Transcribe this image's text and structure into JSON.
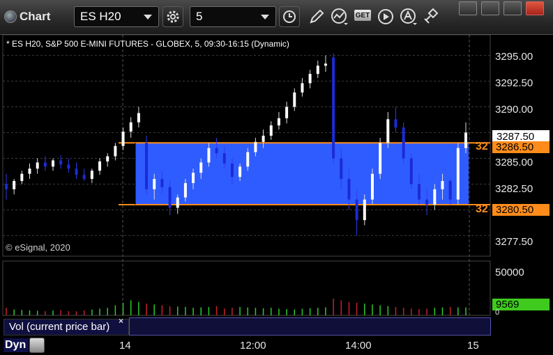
{
  "app": {
    "title": "Chart"
  },
  "toolbar": {
    "symbol": "ES H20",
    "interval": "5",
    "get_label": "GET"
  },
  "chart": {
    "header": "* ES H20, S&P 500 E-MINI FUTURES - GLOBEX, 5, 09:30-16:15 (Dynamic)",
    "copyright": "© eSignal, 2020",
    "price_ticks": [
      "3295.00",
      "3292.50",
      "3290.00",
      "3287.50",
      "3285.00",
      "3282.50",
      "3280.00",
      "3277.50"
    ],
    "tags": {
      "last": "3287.50",
      "upper_line": "3286.50",
      "lower_line": "3280.50",
      "volume": "9569"
    },
    "line_labels": {
      "upper": "32",
      "lower": "32"
    },
    "volume_ticks": [
      "50000",
      "0"
    ],
    "time_ticks": [
      "14",
      "12:00",
      "14:00",
      "15"
    ],
    "volume_panel_label": "Vol (current price bar)",
    "volume_panel_close": "×",
    "dyn_label": "Dyn"
  },
  "colors": {
    "up_candle": "#ffffff",
    "down_candle": "#1a2bd6",
    "band_fill": "#2f5cff",
    "band_line": "#ff8c1a",
    "vol_up": "#2fc82f",
    "vol_down": "#c8202a",
    "grid": "#3a3a3a"
  },
  "chart_data": {
    "type": "candlestick",
    "price_range": [
      3275.5,
      3297.0
    ],
    "volume_range": [
      0,
      65000
    ],
    "band": {
      "top": 3286.5,
      "bottom": 3280.5
    },
    "candles": [
      [
        3282.5,
        3283.5,
        3281.0,
        3282.0
      ],
      [
        3282.0,
        3283.0,
        3281.5,
        3282.8
      ],
      [
        3282.8,
        3283.8,
        3282.5,
        3283.5
      ],
      [
        3283.5,
        3284.5,
        3283.0,
        3284.0
      ],
      [
        3284.0,
        3285.0,
        3283.5,
        3284.6
      ],
      [
        3284.6,
        3285.2,
        3283.8,
        3284.2
      ],
      [
        3284.2,
        3285.0,
        3283.8,
        3284.8
      ],
      [
        3284.8,
        3285.3,
        3284.0,
        3284.4
      ],
      [
        3284.4,
        3285.0,
        3283.6,
        3284.0
      ],
      [
        3284.0,
        3284.6,
        3283.0,
        3283.4
      ],
      [
        3283.4,
        3284.0,
        3282.8,
        3283.0
      ],
      [
        3283.0,
        3284.0,
        3282.6,
        3283.8
      ],
      [
        3283.8,
        3285.0,
        3283.4,
        3284.7
      ],
      [
        3284.7,
        3285.5,
        3284.2,
        3285.2
      ],
      [
        3285.2,
        3286.5,
        3284.8,
        3286.2
      ],
      [
        3286.2,
        3288.0,
        3285.8,
        3287.6
      ],
      [
        3287.6,
        3289.0,
        3287.0,
        3288.5
      ],
      [
        3288.5,
        3290.0,
        3288.0,
        3289.4
      ],
      [
        3286.5,
        3287.2,
        3281.5,
        3282.0
      ],
      [
        3282.0,
        3283.5,
        3281.0,
        3283.0
      ],
      [
        3283.0,
        3283.8,
        3281.6,
        3282.2
      ],
      [
        3282.2,
        3282.8,
        3279.5,
        3280.2
      ],
      [
        3280.2,
        3281.5,
        3279.6,
        3281.2
      ],
      [
        3281.2,
        3283.0,
        3280.8,
        3282.6
      ],
      [
        3282.6,
        3284.0,
        3282.0,
        3283.6
      ],
      [
        3283.6,
        3285.0,
        3283.0,
        3284.6
      ],
      [
        3284.6,
        3286.5,
        3284.2,
        3286.0
      ],
      [
        3286.0,
        3287.0,
        3285.0,
        3285.5
      ],
      [
        3285.5,
        3286.2,
        3284.0,
        3284.5
      ],
      [
        3284.5,
        3285.0,
        3282.5,
        3283.2
      ],
      [
        3283.2,
        3284.5,
        3282.8,
        3284.2
      ],
      [
        3284.2,
        3286.0,
        3283.8,
        3285.6
      ],
      [
        3285.6,
        3287.0,
        3285.2,
        3286.6
      ],
      [
        3286.6,
        3287.8,
        3286.0,
        3287.2
      ],
      [
        3287.2,
        3288.6,
        3286.8,
        3288.2
      ],
      [
        3288.2,
        3289.5,
        3287.8,
        3288.9
      ],
      [
        3288.9,
        3290.5,
        3288.4,
        3290.0
      ],
      [
        3290.0,
        3291.8,
        3289.6,
        3291.4
      ],
      [
        3291.4,
        3292.8,
        3291.0,
        3292.3
      ],
      [
        3292.3,
        3293.6,
        3291.8,
        3293.2
      ],
      [
        3293.2,
        3294.5,
        3292.8,
        3294.0
      ],
      [
        3294.0,
        3295.0,
        3293.4,
        3294.2
      ],
      [
        3294.8,
        3295.2,
        3284.5,
        3285.0
      ],
      [
        3285.0,
        3286.0,
        3282.0,
        3283.0
      ],
      [
        3283.0,
        3284.0,
        3280.0,
        3281.0
      ],
      [
        3281.0,
        3282.0,
        3277.5,
        3279.0
      ],
      [
        3279.0,
        3281.5,
        3278.5,
        3281.0
      ],
      [
        3281.0,
        3284.0,
        3280.5,
        3283.5
      ],
      [
        3283.5,
        3287.0,
        3283.0,
        3286.5
      ],
      [
        3286.5,
        3289.5,
        3286.0,
        3288.8
      ],
      [
        3288.8,
        3290.0,
        3287.5,
        3288.0
      ],
      [
        3288.0,
        3288.5,
        3284.5,
        3285.0
      ],
      [
        3285.0,
        3285.5,
        3282.0,
        3282.5
      ],
      [
        3282.5,
        3283.5,
        3280.5,
        3281.0
      ],
      [
        3281.0,
        3282.0,
        3279.5,
        3280.5
      ],
      [
        3280.5,
        3282.5,
        3280.0,
        3282.0
      ],
      [
        3282.0,
        3283.5,
        3281.0,
        3282.8
      ],
      [
        3282.8,
        3283.0,
        3280.5,
        3281.0
      ],
      [
        3281.0,
        3286.5,
        3280.5,
        3286.0
      ],
      [
        3286.0,
        3288.5,
        3285.5,
        3287.5
      ]
    ],
    "volumes": [
      9000,
      7000,
      6500,
      6000,
      5500,
      5000,
      5800,
      6200,
      5000,
      4800,
      6000,
      7000,
      8000,
      9000,
      12000,
      15000,
      18000,
      16000,
      14000,
      13000,
      12000,
      11000,
      10500,
      10000,
      9000,
      9500,
      10000,
      11000,
      8000,
      9000,
      10000,
      9500,
      9000,
      8500,
      9000,
      8000,
      7500,
      7000,
      7800,
      8500,
      9000,
      9500,
      20000,
      18000,
      16000,
      15000,
      14000,
      13000,
      12000,
      11000,
      10000,
      9000,
      8000,
      7500,
      8000,
      9000,
      9500,
      10000,
      9569,
      9569
    ]
  }
}
